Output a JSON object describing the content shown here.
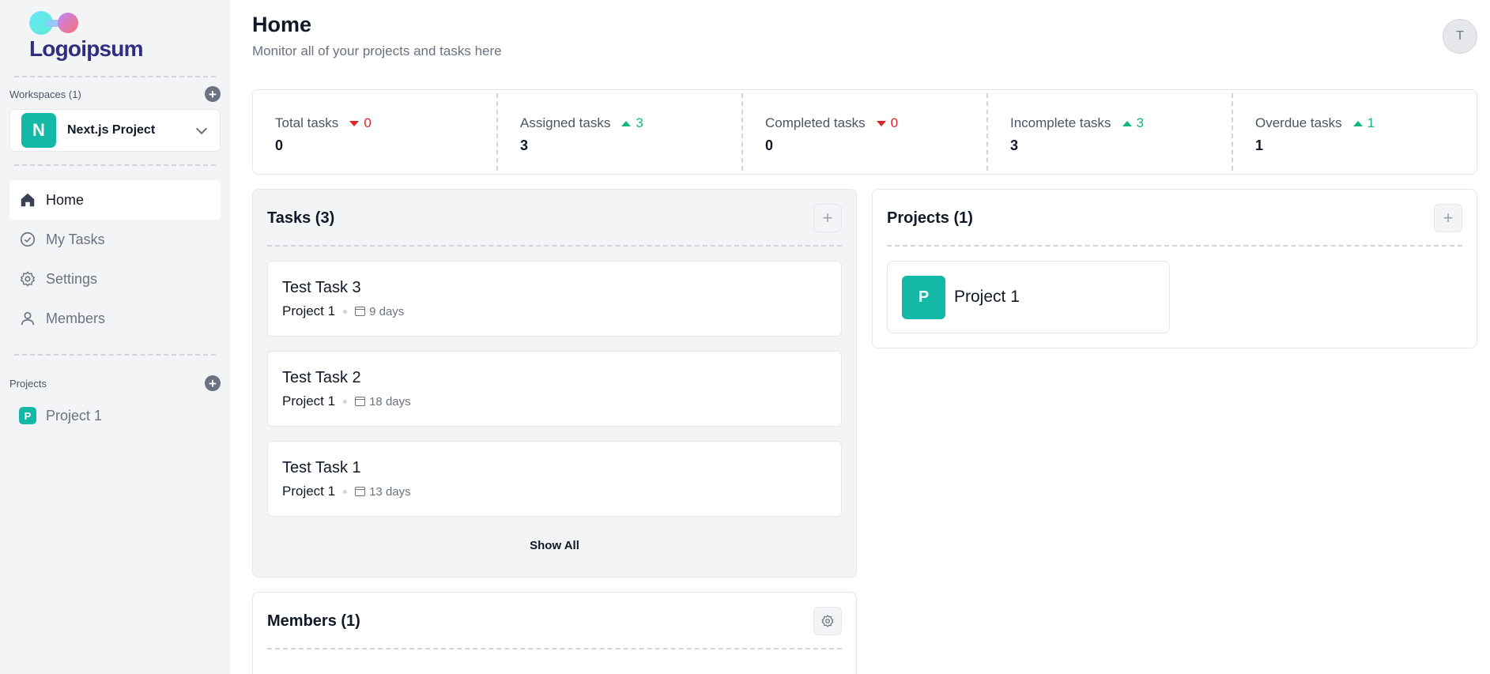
{
  "brand": {
    "logo_text": "Logoipsum"
  },
  "sidebar": {
    "workspaces_label": "Workspaces (1)",
    "workspace": {
      "initial": "N",
      "name": "Next.js Project"
    },
    "nav": [
      {
        "label": "Home",
        "icon": "home-icon"
      },
      {
        "label": "My Tasks",
        "icon": "check-circle-icon"
      },
      {
        "label": "Settings",
        "icon": "gear-icon"
      },
      {
        "label": "Members",
        "icon": "user-icon"
      }
    ],
    "projects_label": "Projects",
    "projects": [
      {
        "initial": "P",
        "name": "Project 1"
      }
    ]
  },
  "header": {
    "title": "Home",
    "subtitle": "Monitor all of your projects and tasks here",
    "user_initial": "T"
  },
  "stats": [
    {
      "label": "Total tasks",
      "change": "0",
      "trend": "down",
      "value": "0"
    },
    {
      "label": "Assigned tasks",
      "change": "3",
      "trend": "up",
      "value": "3"
    },
    {
      "label": "Completed tasks",
      "change": "0",
      "trend": "down",
      "value": "0"
    },
    {
      "label": "Incomplete tasks",
      "change": "3",
      "trend": "up",
      "value": "3"
    },
    {
      "label": "Overdue tasks",
      "change": "1",
      "trend": "up",
      "value": "1"
    }
  ],
  "tasks_card": {
    "title": "Tasks (3)",
    "tasks": [
      {
        "name": "Test Task 3",
        "project": "Project 1",
        "due": "9 days"
      },
      {
        "name": "Test Task 2",
        "project": "Project 1",
        "due": "18 days"
      },
      {
        "name": "Test Task 1",
        "project": "Project 1",
        "due": "13 days"
      }
    ],
    "show_all": "Show All"
  },
  "projects_card": {
    "title": "Projects (1)",
    "projects": [
      {
        "initial": "P",
        "name": "Project 1"
      }
    ]
  },
  "members_card": {
    "title": "Members (1)"
  },
  "colors": {
    "accent": "#14b8a6",
    "up": "#10b981",
    "down": "#dc2626",
    "brand": "#312e81"
  }
}
